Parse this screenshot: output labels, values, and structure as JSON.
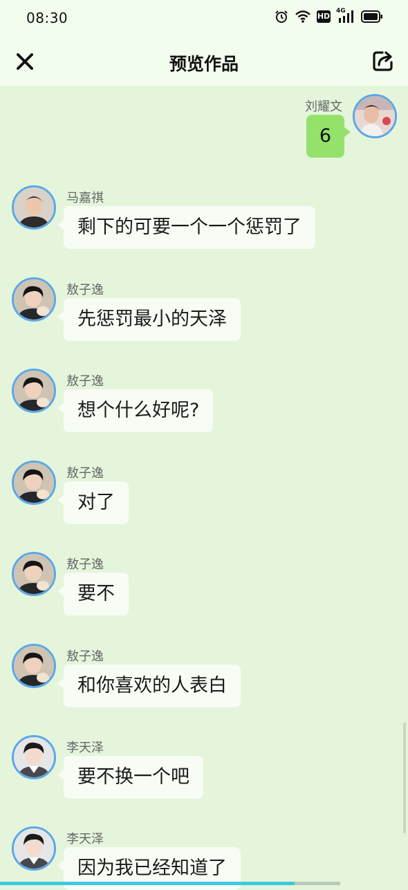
{
  "status_bar": {
    "time": "08:30",
    "icons": [
      "alarm-icon",
      "wifi-icon",
      "hd-icon",
      "4g-signal-icon",
      "battery-icon"
    ],
    "hd_label": "HD",
    "network_label": "4G"
  },
  "header": {
    "title": "预览作品",
    "close_icon": "close-icon",
    "share_icon": "share-icon"
  },
  "messages": [
    {
      "side": "right",
      "name": "刘耀文",
      "text": "6"
    },
    {
      "side": "left",
      "name": "马嘉祺",
      "text": "剩下的可要一个一个惩罚了"
    },
    {
      "side": "left",
      "name": "敖子逸",
      "text": "先惩罚最小的天泽"
    },
    {
      "side": "left",
      "name": "敖子逸",
      "text": "想个什么好呢?"
    },
    {
      "side": "left",
      "name": "敖子逸",
      "text": "对了"
    },
    {
      "side": "left",
      "name": "敖子逸",
      "text": "要不"
    },
    {
      "side": "left",
      "name": "敖子逸",
      "text": "和你喜欢的人表白"
    },
    {
      "side": "left",
      "name": "李天泽",
      "text": "要不换一个吧"
    },
    {
      "side": "left",
      "name": "李天泽",
      "text": "因为我已经知道了"
    }
  ],
  "playback_progress": 0.865,
  "colors": {
    "background": "#e4f5dc",
    "bar": "#f3fdee",
    "my_bubble": "#95e26b",
    "other_bubble": "#f7fcf4",
    "avatar_ring": "#5aa7e6",
    "progress": "#3ec9e0"
  }
}
